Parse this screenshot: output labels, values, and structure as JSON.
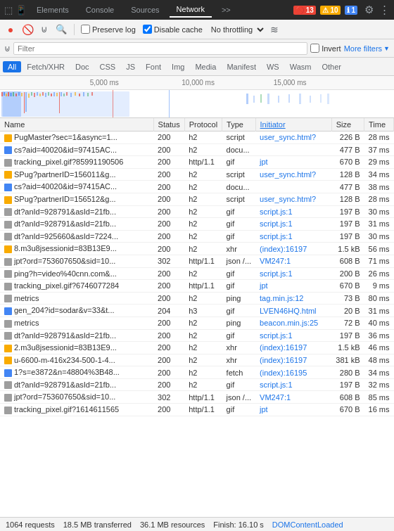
{
  "devtools": {
    "tabs": [
      {
        "label": "Elements",
        "active": false
      },
      {
        "label": "Console",
        "active": false
      },
      {
        "label": "Sources",
        "active": false
      },
      {
        "label": "Network",
        "active": true
      },
      {
        "label": ">>",
        "active": false
      }
    ],
    "badges": {
      "errors": "13",
      "warnings": "10",
      "info": "1"
    },
    "icons": {
      "settings": "⚙",
      "more": "⋮",
      "inspect": "⬚",
      "device": "📱"
    }
  },
  "network_toolbar": {
    "record_label": "●",
    "clear_label": "🚫",
    "filter_label": "⊍",
    "search_label": "🔍",
    "preserve_log_label": "Preserve log",
    "disable_cache_label": "Disable cache",
    "throttling_label": "No throttling",
    "wifi_label": "≋"
  },
  "filter_bar": {
    "placeholder": "Filter",
    "invert_label": "Invert",
    "more_filters_label": "More filters",
    "chevron": "▼"
  },
  "type_filters": [
    {
      "label": "All",
      "active": true
    },
    {
      "label": "Fetch/XHR",
      "active": false
    },
    {
      "label": "Doc",
      "active": false
    },
    {
      "label": "CSS",
      "active": false
    },
    {
      "label": "JS",
      "active": false
    },
    {
      "label": "Font",
      "active": false
    },
    {
      "label": "Img",
      "active": false
    },
    {
      "label": "Media",
      "active": false
    },
    {
      "label": "Manifest",
      "active": false
    },
    {
      "label": "WS",
      "active": false
    },
    {
      "label": "Wasm",
      "active": false
    },
    {
      "label": "Other",
      "active": false
    }
  ],
  "timeline": {
    "markers": [
      {
        "label": "5,000 ms",
        "position": "22%"
      },
      {
        "label": "10,000 ms",
        "position": "48%"
      },
      {
        "label": "15,000 ms",
        "position": "74%"
      }
    ]
  },
  "table": {
    "columns": [
      "Name",
      "Status",
      "Protocol",
      "Type",
      "Initiator",
      "Size",
      "Time"
    ],
    "rows": [
      {
        "icon": "orange",
        "check": false,
        "name": "PugMaster?sec=1&async=1...",
        "status": "200",
        "protocol": "h2",
        "type": "script",
        "initiator": "user_sync.html?",
        "size": "226 B",
        "time": "28 ms"
      },
      {
        "icon": "blue",
        "check": false,
        "name": "cs?aid=40020&id=97415AC...",
        "status": "200",
        "protocol": "h2",
        "type": "docu...",
        "initiator": "",
        "size": "477 B",
        "time": "37 ms"
      },
      {
        "icon": "gray",
        "check": false,
        "name": "tracking_pixel.gif?85991190506",
        "status": "200",
        "protocol": "http/1.1",
        "type": "gif",
        "initiator": "jpt",
        "size": "670 B",
        "time": "29 ms"
      },
      {
        "icon": "orange",
        "check": false,
        "name": "SPug?partnerID=156011&g...",
        "status": "200",
        "protocol": "h2",
        "type": "script",
        "initiator": "user_sync.html?",
        "size": "128 B",
        "time": "34 ms"
      },
      {
        "icon": "blue",
        "check": false,
        "name": "cs?aid=40020&id=97415AC...",
        "status": "200",
        "protocol": "h2",
        "type": "docu...",
        "initiator": "",
        "size": "477 B",
        "time": "38 ms"
      },
      {
        "icon": "orange",
        "check": false,
        "name": "SPug?partnerID=156512&g...",
        "status": "200",
        "protocol": "h2",
        "type": "script",
        "initiator": "user_sync.html?",
        "size": "128 B",
        "time": "28 ms"
      },
      {
        "icon": "gray",
        "check": false,
        "name": "dt?anId=928791&asId=21fb...",
        "status": "200",
        "protocol": "h2",
        "type": "gif",
        "initiator": "script.js:1",
        "size": "197 B",
        "time": "30 ms"
      },
      {
        "icon": "gray",
        "check": false,
        "name": "dt?anId=928791&asId=21fb...",
        "status": "200",
        "protocol": "h2",
        "type": "gif",
        "initiator": "script.js:1",
        "size": "197 B",
        "time": "31 ms"
      },
      {
        "icon": "gray",
        "check": false,
        "name": "dt?anId=925660&asId=7224...",
        "status": "200",
        "protocol": "h2",
        "type": "gif",
        "initiator": "script.js:1",
        "size": "197 B",
        "time": "30 ms"
      },
      {
        "icon": "orange",
        "check": false,
        "name": "8.m3u8jsessionid=83B13E9...",
        "status": "200",
        "protocol": "h2",
        "type": "xhr",
        "initiator": "(index):16197",
        "size": "1.5 kB",
        "time": "56 ms"
      },
      {
        "icon": "gray",
        "check": false,
        "name": "jpt?ord=753607650&sid=10...",
        "status": "302",
        "protocol": "http/1.1",
        "type": "json /...",
        "initiator": "VM247:1",
        "size": "608 B",
        "time": "71 ms"
      },
      {
        "icon": "gray",
        "check": false,
        "name": "ping?h=video%40cnn.com&...",
        "status": "200",
        "protocol": "h2",
        "type": "gif",
        "initiator": "script.js:1",
        "size": "200 B",
        "time": "26 ms"
      },
      {
        "icon": "gray",
        "check": false,
        "name": "tracking_pixel.gif?6746077284",
        "status": "200",
        "protocol": "http/1.1",
        "type": "gif",
        "initiator": "jpt",
        "size": "670 B",
        "time": "9 ms"
      },
      {
        "icon": "gray",
        "check": false,
        "name": "metrics",
        "status": "200",
        "protocol": "h2",
        "type": "ping",
        "initiator": "tag.min.js:12",
        "size": "73 B",
        "time": "80 ms"
      },
      {
        "icon": "blue",
        "check": false,
        "name": "gen_204?id=sodar&v=33&t...",
        "status": "204",
        "protocol": "h3",
        "type": "gif",
        "initiator": "LVEN46HQ.html",
        "size": "20 B",
        "time": "31 ms"
      },
      {
        "icon": "gray",
        "check": false,
        "name": "metrics",
        "status": "200",
        "protocol": "h2",
        "type": "ping",
        "initiator": "beacon.min.js:25",
        "size": "72 B",
        "time": "40 ms"
      },
      {
        "icon": "gray",
        "check": false,
        "name": "dt?anId=928791&asId=21fb...",
        "status": "200",
        "protocol": "h2",
        "type": "gif",
        "initiator": "script.js:1",
        "size": "197 B",
        "time": "36 ms"
      },
      {
        "icon": "orange",
        "check": false,
        "name": "2.m3u8jsessionid=83B13E9...",
        "status": "200",
        "protocol": "h2",
        "type": "xhr",
        "initiator": "(index):16197",
        "size": "1.5 kB",
        "time": "46 ms"
      },
      {
        "icon": "orange",
        "check": false,
        "name": "u-6600-m-416x234-500-1-4...",
        "status": "200",
        "protocol": "h2",
        "type": "xhr",
        "initiator": "(index):16197",
        "size": "381 kB",
        "time": "48 ms"
      },
      {
        "icon": "blue",
        "check": false,
        "name": "1?s=e3872&n=48804%3B48...",
        "status": "200",
        "protocol": "h2",
        "type": "fetch",
        "initiator": "(index):16195",
        "size": "280 B",
        "time": "34 ms"
      },
      {
        "icon": "gray",
        "check": false,
        "name": "dt?anId=928791&asId=21fb...",
        "status": "200",
        "protocol": "h2",
        "type": "gif",
        "initiator": "script.js:1",
        "size": "197 B",
        "time": "32 ms"
      },
      {
        "icon": "gray",
        "check": false,
        "name": "jpt?ord=753607650&sid=10...",
        "status": "302",
        "protocol": "http/1.1",
        "type": "json /...",
        "initiator": "VM247:1",
        "size": "608 B",
        "time": "85 ms"
      },
      {
        "icon": "gray",
        "check": false,
        "name": "tracking_pixel.gif?1614611565",
        "status": "200",
        "protocol": "http/1.1",
        "type": "gif",
        "initiator": "jpt",
        "size": "670 B",
        "time": "16 ms"
      }
    ]
  },
  "status_bar": {
    "requests": "1064 requests",
    "transferred": "18.5 MB transferred",
    "resources": "36.1 MB resources",
    "finish": "Finish: 16.10 s",
    "dom_content_loaded": "DOMContentLoaded"
  }
}
